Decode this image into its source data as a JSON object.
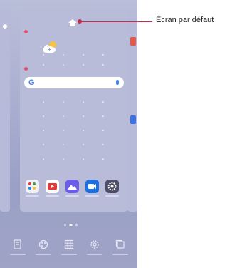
{
  "callout": {
    "label": "Écran par défaut"
  },
  "colors": {
    "callout": "#c62b4b",
    "indicator_dot": "#e94c6b",
    "wallpaper": "#a9aed0"
  },
  "main_screen": {
    "search_bar": {
      "logo": "G",
      "mic_icon": "mic-icon"
    },
    "weather_icon": "partly-cloudy-icon",
    "dock_apps": [
      {
        "name": "apps-folder",
        "color": "#f1f1f7"
      },
      {
        "name": "youtube",
        "color": "#e53935"
      },
      {
        "name": "gallery",
        "color": "#6c5ce7"
      },
      {
        "name": "video-call",
        "color": "#1e6fe0"
      },
      {
        "name": "settings",
        "color": "#4c4f66"
      }
    ]
  },
  "bottom_bar": {
    "items": [
      {
        "icon": "wallpaper-icon"
      },
      {
        "icon": "theme-icon"
      },
      {
        "icon": "grid-icon"
      },
      {
        "icon": "settings-icon"
      },
      {
        "icon": "screens-icon"
      }
    ]
  }
}
